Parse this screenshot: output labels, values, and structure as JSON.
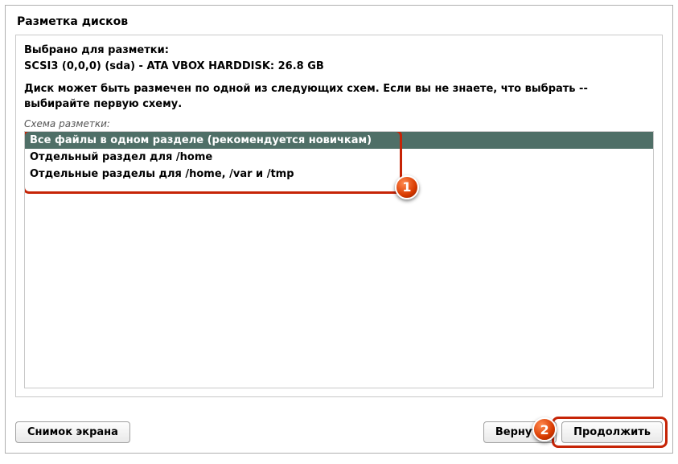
{
  "title": "Разметка дисков",
  "selected_label": "Выбрано для разметки:",
  "disk_info": "SCSI3 (0,0,0) (sda) - ATA VBOX HARDDISK: 26.8 GB",
  "description": "Диск может быть размечен по одной из следующих схем. Если вы не знаете, что выбрать -- выбирайте первую схему.",
  "scheme_label": "Схема разметки:",
  "options": [
    "Все файлы в одном разделе (рекомендуется новичкам)",
    "Отдельный раздел для /home",
    "Отдельные разделы для /home, /var и /tmp"
  ],
  "buttons": {
    "screenshot": "Снимок экрана",
    "back": "Вернуть",
    "continue": "Продолжить"
  },
  "badges": {
    "one": "1",
    "two": "2"
  }
}
